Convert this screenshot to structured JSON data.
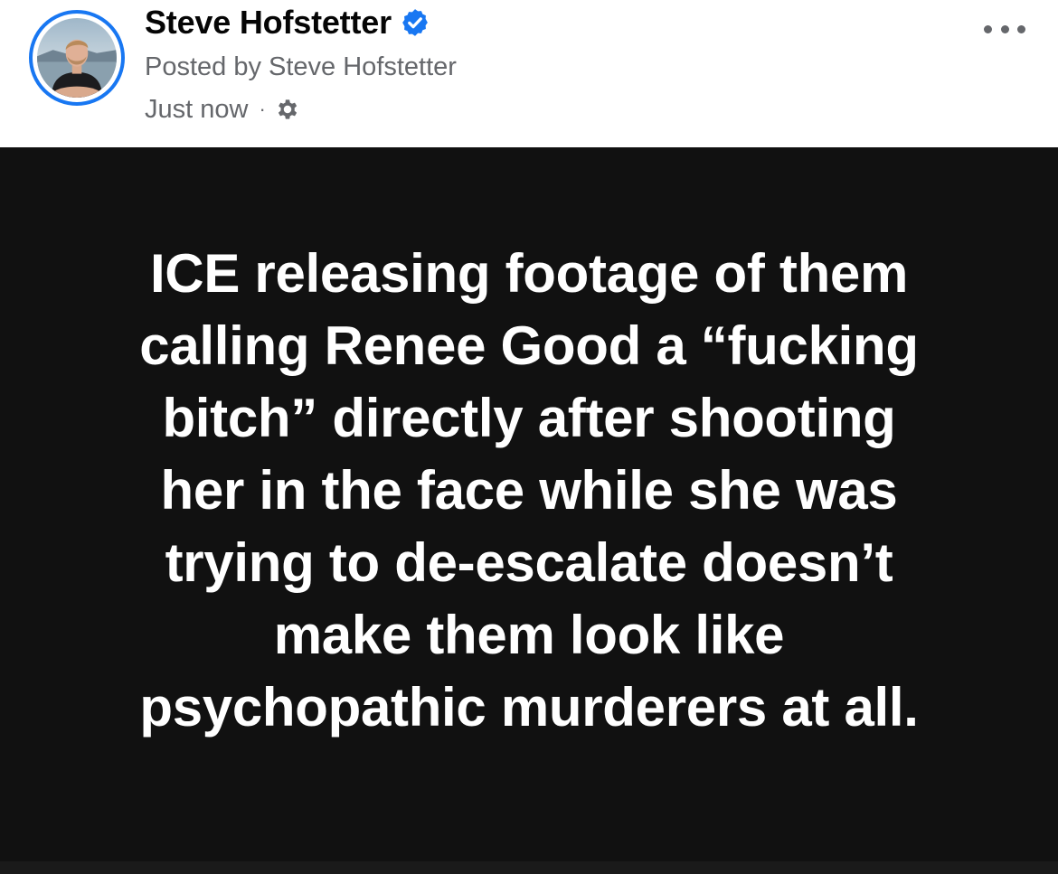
{
  "post": {
    "author_name": "Steve Hofstetter",
    "posted_by": "Posted by Steve Hofstetter",
    "timestamp": "Just now",
    "separator": "·",
    "audience_icon": "gear-icon",
    "verified_icon": "verified-badge-icon",
    "more_icon": "more-options-icon",
    "text_lines": [
      "ICE releasing footage of them",
      "calling Renee Good a “fucking",
      "bitch” directly after shooting",
      "her in the face while she was",
      "trying to de-escalate doesn’t",
      "make them look like",
      "psychopathic murderers at all."
    ],
    "colors": {
      "accent": "#1877f2",
      "card_background": "#111111",
      "card_text": "#ffffff",
      "secondary_text": "#65676b"
    }
  }
}
